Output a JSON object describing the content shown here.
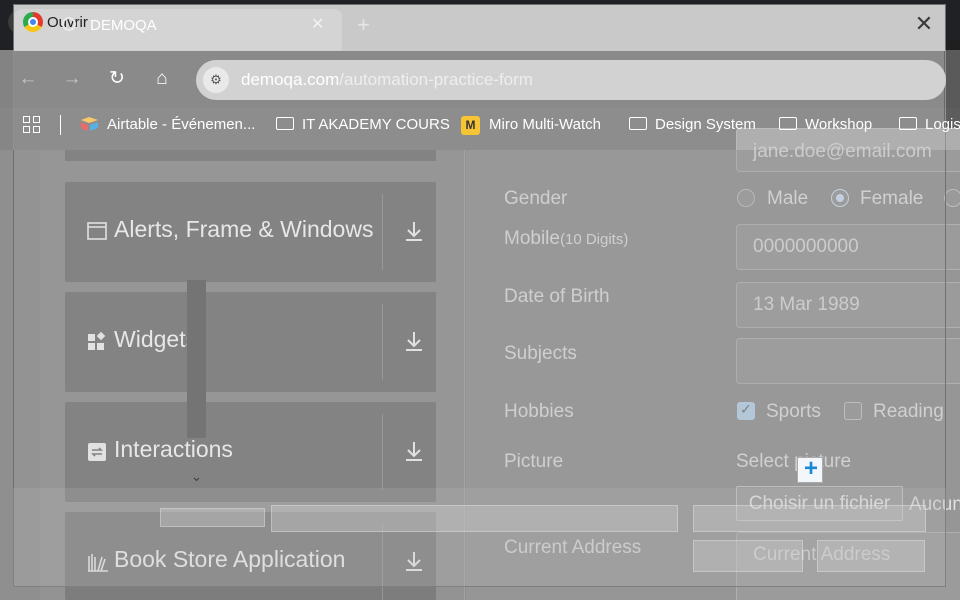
{
  "browser": {
    "ouvrir_label": "Ouvrir",
    "tab_title": "DEMOQA",
    "tab_close": "✕",
    "new_tab": "+",
    "window_close": "✕",
    "url_domain": "demoqa.com",
    "url_path": "/automation-practice-form",
    "nav": {
      "back": "←",
      "forward": "→",
      "reload": "↻",
      "home": "⌂"
    }
  },
  "bookmarks": [
    {
      "label": "Airtable - Événemen...",
      "icon": "airtable-icon"
    },
    {
      "label": "IT AKADEMY COURS",
      "icon": "folder-icon"
    },
    {
      "label": "Miro Multi-Watch",
      "icon": "miro-icon"
    },
    {
      "label": "Design System",
      "icon": "folder-icon"
    },
    {
      "label": "Workshop",
      "icon": "folder-icon"
    },
    {
      "label": "Logis",
      "icon": "folder-icon"
    }
  ],
  "sidebar": {
    "cards": [
      {
        "label": "Alerts, Frame & Windows",
        "icon": "window-icon"
      },
      {
        "label": "Widgets",
        "icon": "widgets-icon"
      },
      {
        "label": "Interactions",
        "icon": "interactions-icon"
      },
      {
        "label": "Book Store Application",
        "icon": "bookstore-icon"
      }
    ]
  },
  "form": {
    "email_value": "jane.doe@email.com",
    "gender_label": "Gender",
    "gender_options": [
      "Male",
      "Female"
    ],
    "gender_selected": "Female",
    "mobile_label": "Mobile",
    "mobile_hint": "(10 Digits)",
    "mobile_value": "0000000000",
    "dob_label": "Date of Birth",
    "dob_value": "13 Mar 1989",
    "subjects_label": "Subjects",
    "subjects_value": "",
    "hobbies_label": "Hobbies",
    "hobbies": [
      {
        "label": "Sports",
        "checked": true
      },
      {
        "label": "Reading",
        "checked": false
      }
    ],
    "picture_label": "Picture",
    "picture_prompt": "Select picture",
    "file_button": "Choisir un fichier",
    "file_status": "Aucun",
    "address_label": "Current Address",
    "address_placeholder": "Current Address"
  },
  "colors": {
    "accent_blue": "#1a8ad6",
    "chrome_red": "#e33b2e",
    "chrome_yellow": "#f5c518",
    "chrome_green": "#2da94f"
  }
}
